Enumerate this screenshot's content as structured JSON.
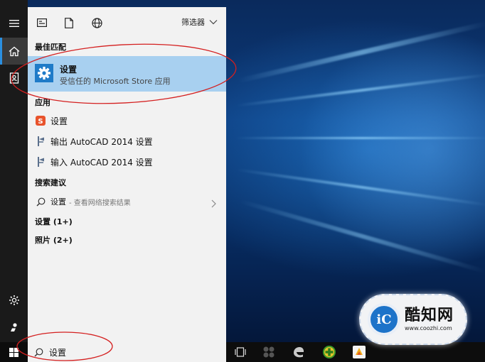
{
  "toolbar": {
    "filter_label": "筛选器",
    "icons": [
      "app-list-icon",
      "document-icon",
      "globe-icon",
      "chevron-down-icon"
    ]
  },
  "best_match": {
    "header": "最佳匹配",
    "title": "设置",
    "subtitle": "受信任的 Microsoft Store 应用",
    "icon": "gear-icon",
    "highlight_color": "#a8d0f0"
  },
  "apps": {
    "header": "应用",
    "items": [
      {
        "label": "设置",
        "icon": "sogou-icon"
      },
      {
        "label": "输出 AutoCAD 2014 设置",
        "icon": "autocad-migration-icon"
      },
      {
        "label": "输入 AutoCAD 2014 设置",
        "icon": "autocad-migration-icon"
      }
    ]
  },
  "suggestions": {
    "header": "搜索建议",
    "items": [
      {
        "label": "设置",
        "sub": "- 查看网络搜索结果",
        "icon": "search-icon"
      }
    ]
  },
  "categories": [
    {
      "label": "设置 (1+)"
    },
    {
      "label": "照片 (2+)"
    }
  ],
  "rail": {
    "items": [
      "hamburger-menu-icon",
      "home-icon",
      "notebook-icon",
      "settings-icon",
      "feedback-icon"
    ],
    "active": "home-icon",
    "accent": "#2a8fe0"
  },
  "taskbar": {
    "search_value": "设置",
    "items": [
      "task-view-icon",
      "app-icon",
      "edge-icon",
      "green-plus-app-icon",
      "sticky-app-icon"
    ]
  },
  "watermark": {
    "logo_text": "iC",
    "name": "酷知网",
    "url": "www.coozhi.com"
  },
  "annotation_color": "#d41f1f"
}
